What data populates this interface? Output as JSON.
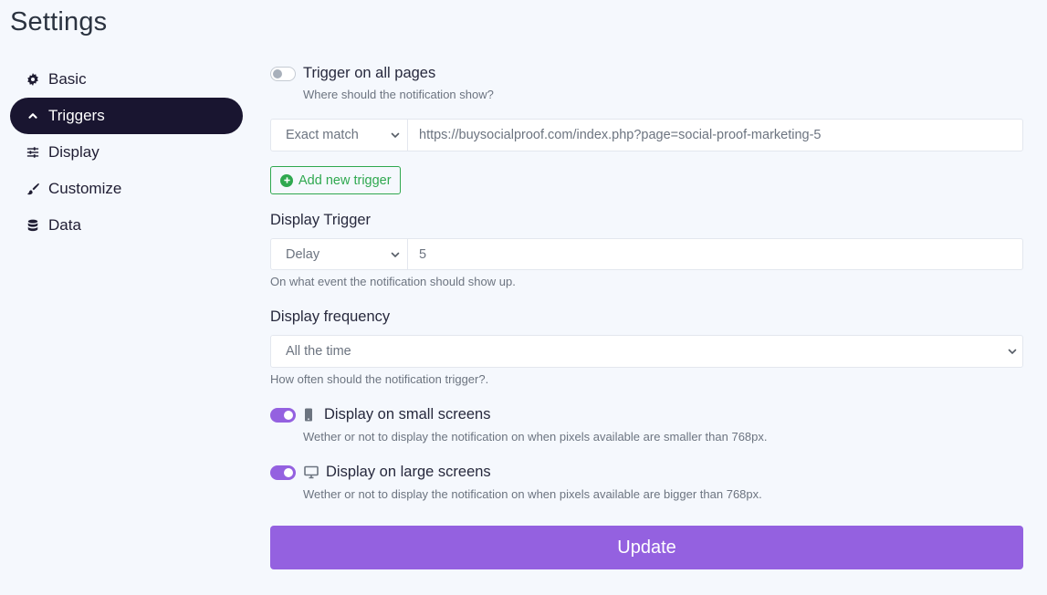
{
  "page": {
    "title": "Settings"
  },
  "sidebar": {
    "items": [
      {
        "label": "Basic",
        "icon": "gear-icon",
        "active": false
      },
      {
        "label": "Triggers",
        "icon": "chevron-up-icon",
        "active": true
      },
      {
        "label": "Display",
        "icon": "sliders-icon",
        "active": false
      },
      {
        "label": "Customize",
        "icon": "paintbrush-icon",
        "active": false
      },
      {
        "label": "Data",
        "icon": "database-icon",
        "active": false
      }
    ]
  },
  "triggers": {
    "all_pages": {
      "label": "Trigger on all pages",
      "enabled": false,
      "help": "Where should the notification show?"
    },
    "rule": {
      "match_type": "Exact match",
      "url": "https://buysocialproof.com/index.php?page=social-proof-marketing-5"
    },
    "add_trigger_label": "Add new trigger",
    "display_trigger": {
      "label": "Display Trigger",
      "type": "Delay",
      "value": "5",
      "help": "On what event the notification should show up."
    },
    "display_frequency": {
      "label": "Display frequency",
      "value": "All the time",
      "help": "How often should the notification trigger?."
    },
    "small_screens": {
      "label": "Display on small screens",
      "enabled": true,
      "icon": "mobile-icon",
      "help": "Wether or not to display the notification on when pixels available are smaller than 768px."
    },
    "large_screens": {
      "label": "Display on large screens",
      "enabled": true,
      "icon": "desktop-icon",
      "help": "Wether or not to display the notification on when pixels available are bigger than 768px."
    }
  },
  "actions": {
    "update_label": "Update"
  },
  "colors": {
    "accent": "#9461e0",
    "sidebar_active": "#191530",
    "success": "#2fa84f",
    "background": "#f5f8fd"
  }
}
